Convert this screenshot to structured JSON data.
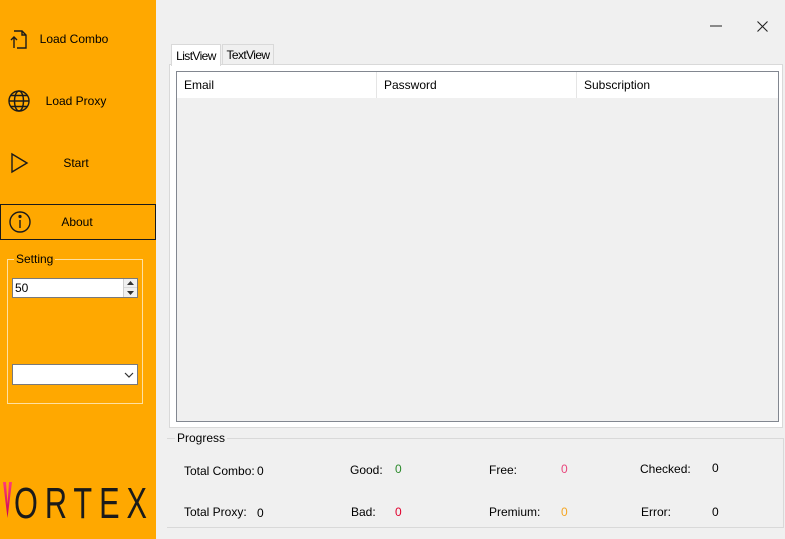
{
  "sidebar": {
    "load_combo": "Load Combo",
    "load_proxy": "Load Proxy",
    "start": "Start",
    "about": "About",
    "setting": {
      "legend": "Setting",
      "threads_value": "50",
      "dropdown_selected": ""
    },
    "logo_text": "ORTEX",
    "icons": {
      "load_combo": "upload-file-icon",
      "load_proxy": "globe-icon",
      "start": "play-icon",
      "about": "info-icon"
    }
  },
  "window": {
    "minimize": "minimize-icon",
    "close": "close-icon"
  },
  "tabs": [
    {
      "label": "ListView",
      "active": true
    },
    {
      "label": "TextView",
      "active": false
    }
  ],
  "listview": {
    "columns": [
      "Email",
      "Password",
      "Subscription"
    ],
    "rows": []
  },
  "progress": {
    "legend": "Progress",
    "total_combo": {
      "label": "Total Combo:",
      "value": "0"
    },
    "total_proxy": {
      "label": "Total Proxy:",
      "value": "0"
    },
    "good": {
      "label": "Good:",
      "value": "0"
    },
    "bad": {
      "label": "Bad:",
      "value": "0"
    },
    "free": {
      "label": "Free:",
      "value": "0"
    },
    "premium": {
      "label": "Premium:",
      "value": "0"
    },
    "checked": {
      "label": "Checked:",
      "value": "0"
    },
    "error": {
      "label": "Error:",
      "value": "0"
    }
  },
  "colors": {
    "sidebar_bg": "#ffa800",
    "good": "#2c8a2c",
    "bad": "#e0002d",
    "free": "#e8467c",
    "premium": "#f5a623"
  }
}
